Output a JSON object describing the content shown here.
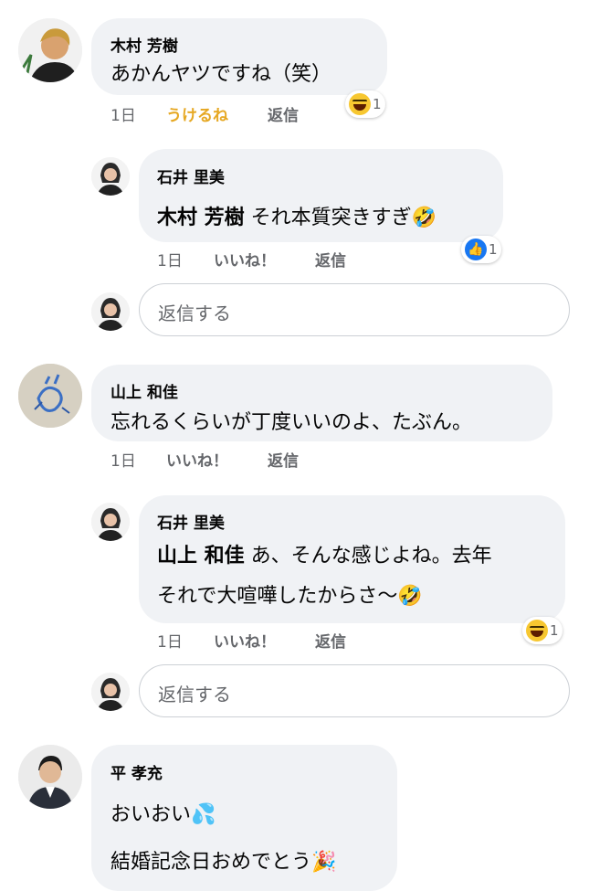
{
  "comments": [
    {
      "name": "木村 芳樹",
      "text": "あかんヤツですね（笑）",
      "time": "1日",
      "like_label": "うけるね",
      "reply_label": "返信",
      "reaction_icon": "laugh-reaction-icon",
      "reaction_count": "1"
    },
    {
      "name": "石井 里美",
      "mention": "木村 芳樹",
      "text": "それ本質突きすぎ🤣",
      "time": "1日",
      "like_label": "いいね！",
      "reply_label": "返信",
      "reaction_icon": "like-reaction-icon",
      "reaction_count": "1"
    },
    {
      "name": "山上 和佳",
      "text": "忘れるくらいが丁度いいのよ、たぶん。",
      "time": "1日",
      "like_label": "いいね！",
      "reply_label": "返信"
    },
    {
      "name": "石井 里美",
      "mention": "山上 和佳",
      "text_line1": "あ、そんな感じよね。去年",
      "text_line2": "それで大喧嘩したからさ〜🤣",
      "time": "1日",
      "like_label": "いいね！",
      "reply_label": "返信",
      "reaction_icon": "laugh-reaction-icon",
      "reaction_count": "1"
    },
    {
      "name": "平 孝充",
      "text_line1": "おいおい💦",
      "text_line2": "結婚記念日おめでとう🎉"
    }
  ],
  "reply_inputs": [
    {
      "placeholder": "返信する"
    },
    {
      "placeholder": "返信する"
    }
  ],
  "colors": {
    "bubble": "#f0f2f5",
    "meta": "#65676b",
    "liked": "#e6a823",
    "like_blue": "#1877f2"
  }
}
